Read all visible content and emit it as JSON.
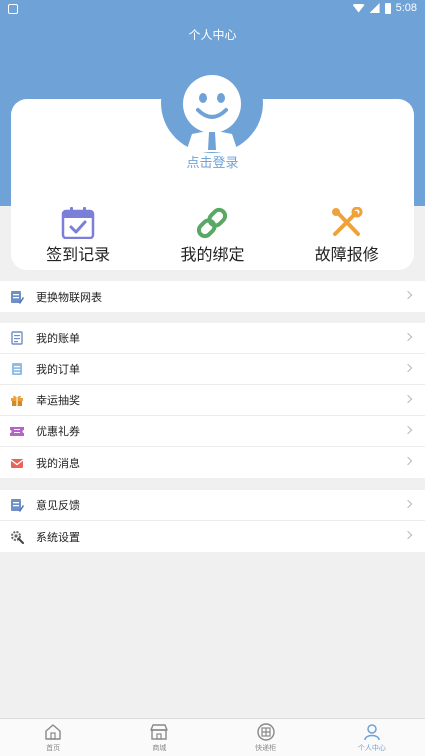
{
  "status_bar": {
    "time": "5:08"
  },
  "header": {
    "title": "个人中心"
  },
  "profile": {
    "login_text": "点击登录"
  },
  "quick_actions": [
    {
      "label": "签到记录",
      "icon": "calendar-check-icon"
    },
    {
      "label": "我的绑定",
      "icon": "link-icon"
    },
    {
      "label": "故障报修",
      "icon": "wrench-screwdriver-icon"
    }
  ],
  "groups": [
    [
      {
        "label": "更换物联网表",
        "icon": "edit-doc-icon"
      }
    ],
    [
      {
        "label": "我的账单",
        "icon": "bill-icon"
      },
      {
        "label": "我的订单",
        "icon": "order-icon"
      },
      {
        "label": "幸运抽奖",
        "icon": "gift-icon"
      },
      {
        "label": "优惠礼券",
        "icon": "coupon-icon"
      },
      {
        "label": "我的消息",
        "icon": "mail-icon"
      }
    ],
    [
      {
        "label": "意见反馈",
        "icon": "feedback-icon"
      },
      {
        "label": "系统设置",
        "icon": "settings-icon"
      }
    ]
  ],
  "tabs": [
    {
      "label": "首页",
      "icon": "home-icon"
    },
    {
      "label": "商城",
      "icon": "shop-icon"
    },
    {
      "label": "快递柜",
      "icon": "locker-icon"
    },
    {
      "label": "个人中心",
      "icon": "user-icon",
      "active": true
    }
  ],
  "colors": {
    "primary": "#6fa2d6",
    "background": "#f0f0f0"
  }
}
